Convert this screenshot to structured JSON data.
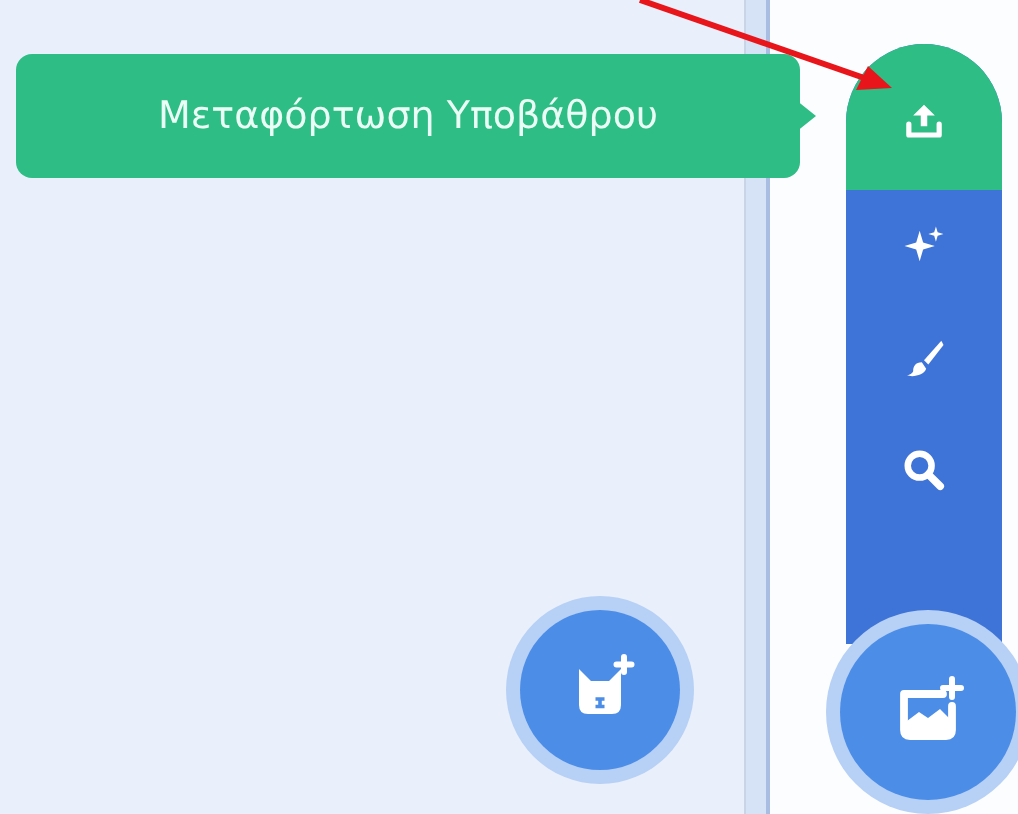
{
  "tooltip": {
    "text": "Μεταφόρτωση Υποβάθρου"
  },
  "backdrop_menu": [
    {
      "kind": "upload",
      "selected": true
    },
    {
      "kind": "surprise",
      "selected": false
    },
    {
      "kind": "paint",
      "selected": false
    },
    {
      "kind": "search",
      "selected": false
    }
  ],
  "floating_buttons": [
    {
      "kind": "sprite"
    },
    {
      "kind": "backdrop"
    }
  ]
}
